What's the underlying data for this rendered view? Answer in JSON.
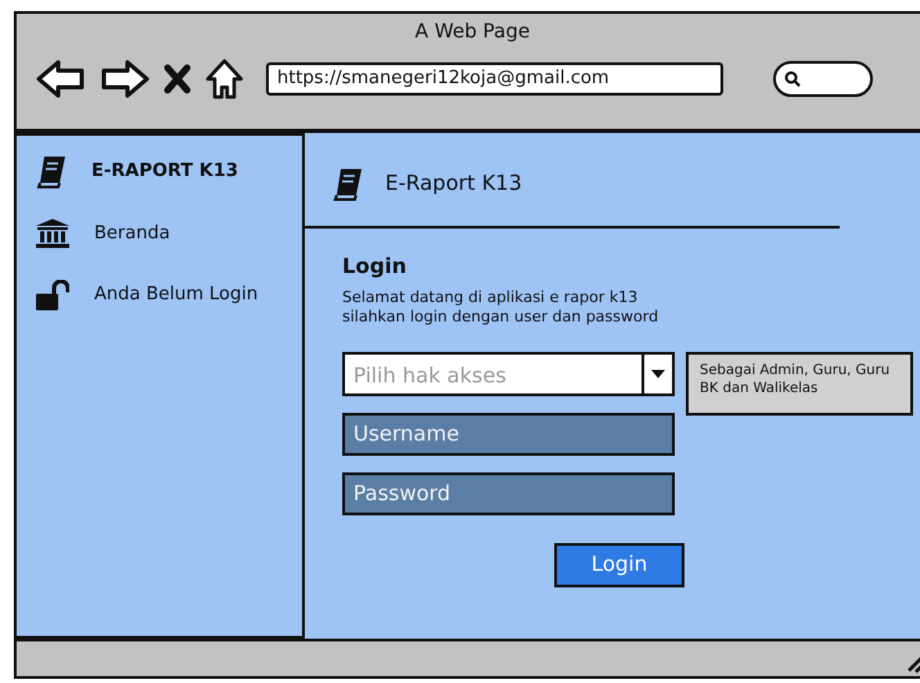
{
  "window": {
    "title": "A Web Page"
  },
  "toolbar": {
    "url": "https://smanegeri12koja@gmail.com"
  },
  "sidebar": {
    "items": [
      {
        "kind": "brand",
        "label": "E-RAPORT K13"
      },
      {
        "kind": "link",
        "label": "Beranda"
      },
      {
        "kind": "link",
        "label": "Anda Belum Login"
      }
    ]
  },
  "header": {
    "title": "E-Raport K13"
  },
  "login": {
    "heading": "Login",
    "intro": [
      "Selamat datang di aplikasi e rapor k13",
      "silahkan login dengan user dan password"
    ],
    "access_select": {
      "placeholder": "Pilih hak akses"
    },
    "hint": "Sebagai Admin, Guru, Guru BK dan Walikelas",
    "username": {
      "placeholder": "Username"
    },
    "password": {
      "placeholder": "Password"
    },
    "button": "Login"
  }
}
